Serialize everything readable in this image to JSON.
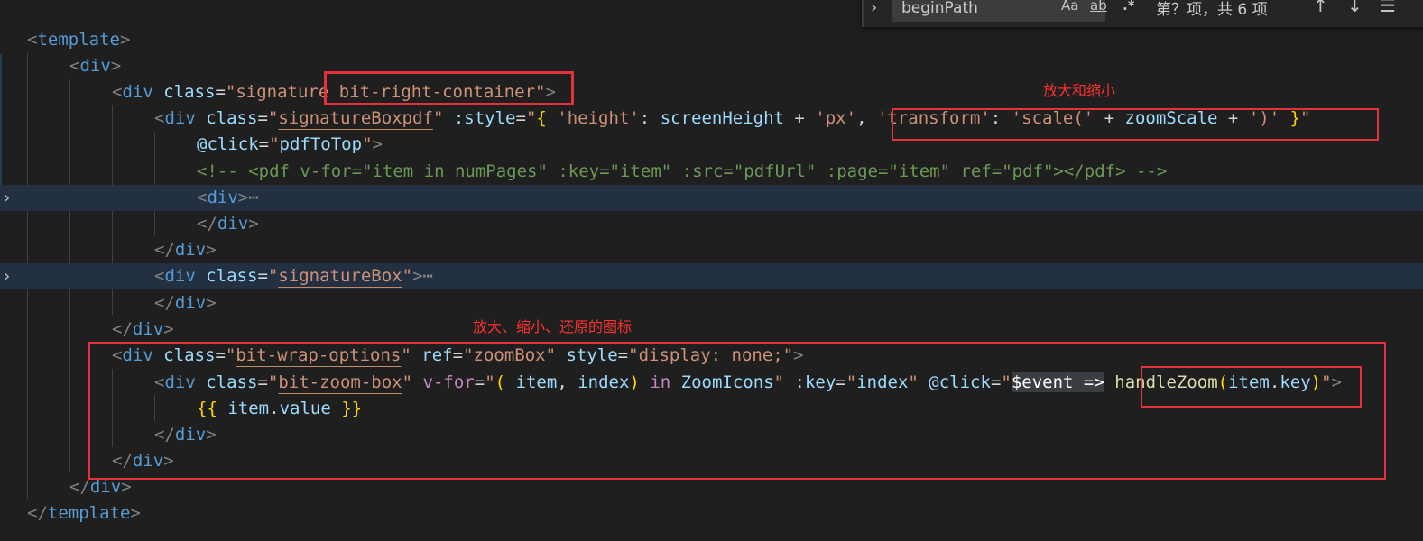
{
  "find_widget": {
    "query": "beginPath",
    "match_case_label": "Aa",
    "whole_word_label": "ab",
    "regex_label": ".*",
    "result_count": "第？项，共 6 项",
    "toggle_icon": "chevron-right-icon",
    "prev_icon": "arrow-up-icon",
    "next_icon": "arrow-down-icon",
    "menu_icon": "menu-icon"
  },
  "annotations": {
    "zoom_note": "放大和缩小",
    "icons_note": "放大、缩小、还原的图标"
  },
  "colors": {
    "annotation": "#e5323a",
    "editor_bg": "#1f1f1f"
  },
  "code": {
    "l1": {
      "o": "<",
      "tag": "template",
      "c": ">"
    },
    "l2": {
      "o": "<",
      "tag": "div",
      "c": ">"
    },
    "l3": {
      "o": "<",
      "tag": "div",
      "sp": " ",
      "attr": "class",
      "eq": "=",
      "val": "\"signature bit-right-container\"",
      "c": ">"
    },
    "l4": {
      "o": "<",
      "tag": "div",
      "sp": " ",
      "attr": "class",
      "eq": "=",
      "q1": "\"",
      "val": "signatureBoxpdf",
      "q2": "\"",
      "sp2": " ",
      "battr": ":style",
      "eq2": "=",
      "q3": "\"",
      "b1": "{",
      "s1": " 'height'",
      "t1": ": ",
      "id1": "screenHeight",
      "t2": " + ",
      "s2": "'px'",
      "t3": ", ",
      "s3": "'transform'",
      "t4": ": ",
      "s4": "'scale('",
      "t5": " + ",
      "id2": "zoomScale",
      "t6": " + ",
      "s5": "')'",
      "t7": " ",
      "b2": "}",
      "q4": "\""
    },
    "l5": {
      "attr": "@click",
      "eq": "=",
      "q1": "\"",
      "fn": "pdfToTop",
      "q2": "\"",
      "c": ">"
    },
    "l6": {
      "comment": "<!-- <pdf v-for=\"item in numPages\" :key=\"item\" :src=\"pdfUrl\" :page=\"item\" ref=\"pdf\"></pdf> -->"
    },
    "l7": {
      "o": "<",
      "tag": "div",
      "c": ">",
      "dots": "⋯"
    },
    "l8": {
      "o": "</",
      "tag": "div",
      "c": ">"
    },
    "l9": {
      "o": "</",
      "tag": "div",
      "c": ">"
    },
    "l10": {
      "o": "<",
      "tag": "div",
      "sp": " ",
      "attr": "class",
      "eq": "=",
      "q1": "\"",
      "val": "signatureBox",
      "q2": "\"",
      "c": ">",
      "dots": "⋯"
    },
    "l11": {
      "o": "</",
      "tag": "div",
      "c": ">"
    },
    "l12": {
      "o": "</",
      "tag": "div",
      "c": ">"
    },
    "l13": {
      "o": "<",
      "tag": "div",
      "sp": " ",
      "attr": "class",
      "eq": "=",
      "q1": "\"",
      "val": "bit-wrap-options",
      "q2": "\"",
      "sp2": " ",
      "attr2": "ref",
      "eq2": "=",
      "val2": "\"zoomBox\"",
      "sp3": " ",
      "attr3": "style",
      "eq3": "=",
      "val3": "\"display: none;\"",
      "c": ">"
    },
    "l14": {
      "o": "<",
      "tag": "div",
      "sp": " ",
      "attr": "class",
      "eq": "=",
      "q1": "\"",
      "val": "bit-zoom-box",
      "q2": "\"",
      "sp2": " ",
      "kattr": "v-for",
      "eq2": "=",
      "q3": "\"",
      "p1": "(",
      "t1": " ",
      "id1": "item",
      "t2": ", ",
      "id2": "index",
      "p2": ")",
      "t3": " ",
      "kw": "in",
      "t4": " ",
      "id3": "ZoomIcons",
      "q4": "\"",
      "sp3": " ",
      "attr3": ":key",
      "eq3": "=",
      "q5": "\"",
      "id4": "index",
      "q6": "\"",
      "sp4": " ",
      "attr4": "@click",
      "eq4": "=",
      "q7": "\"",
      "sel": "$event =>",
      "t5": " ",
      "fn": "handleZoom",
      "p3": "(",
      "id5": "item",
      "dot": ".",
      "id6": "key",
      "p4": ")",
      "q8": "\"",
      "c": ">"
    },
    "l15": {
      "b1": "{{",
      "t1": " ",
      "id1": "item",
      "dot": ".",
      "id2": "value",
      "t2": " ",
      "b2": "}}"
    },
    "l16": {
      "o": "</",
      "tag": "div",
      "c": ">"
    },
    "l17": {
      "o": "</",
      "tag": "div",
      "c": ">"
    },
    "l18": {
      "o": "</",
      "tag": "div",
      "c": ">"
    },
    "l19": {
      "o": "</",
      "tag": "template",
      "c": ">"
    }
  }
}
